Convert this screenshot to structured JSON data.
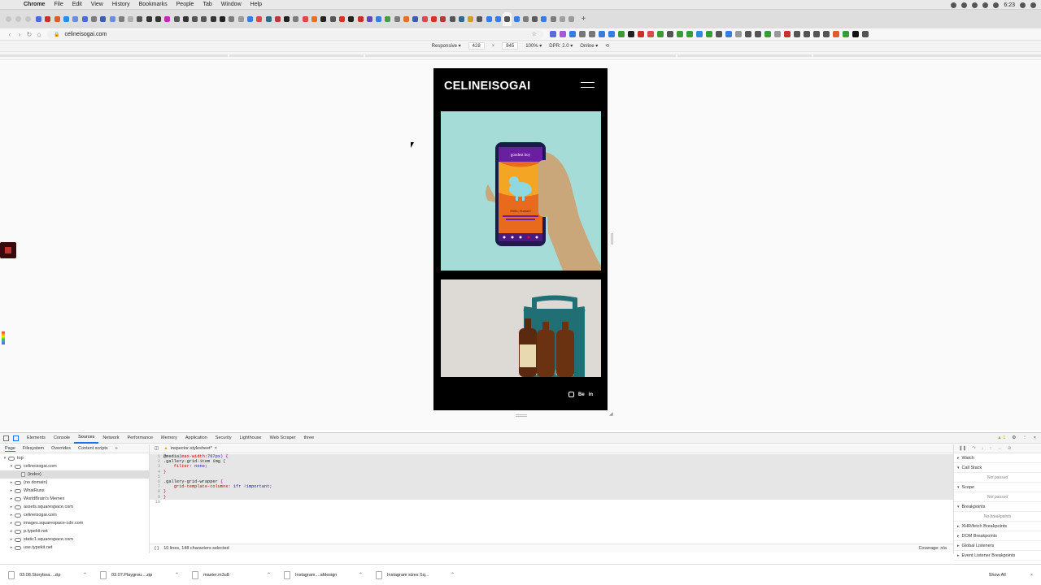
{
  "menubar": {
    "items": [
      "Chrome",
      "File",
      "Edit",
      "View",
      "History",
      "Bookmarks",
      "People",
      "Tab",
      "Window",
      "Help"
    ],
    "time": "6:23"
  },
  "tabs": {
    "favicon_colors": [
      "#4a6bd8",
      "#c9302c",
      "#e05a2b",
      "#2f8be0",
      "#6a8fd8",
      "#4a6bd8",
      "#7c7c7c",
      "#3a5fb0",
      "#6a8fd8",
      "#7c7c7c",
      "#b0b0b0",
      "#555555",
      "#333333",
      "#333333",
      "#c02ab5",
      "#555555",
      "#333333",
      "#555555",
      "#555555",
      "#333333",
      "#222222",
      "#7c7c7c",
      "#9a9a9a",
      "#3a7be0",
      "#d94a4a",
      "#2d6b8a",
      "#b53b3b",
      "#222222",
      "#7c7c7c",
      "#d94a4a",
      "#e0712b",
      "#222222",
      "#555555",
      "#d9302c",
      "#222222",
      "#c9302c",
      "#5d4ab5",
      "#3a7be0",
      "#4a9a4a",
      "#7c7c7c",
      "#e0712b",
      "#3a5fb0",
      "#d94a4a",
      "#d9302c",
      "#b53b3b",
      "#555555",
      "#2d6b8a",
      "#c9a02c",
      "#555555",
      "#3a7be0",
      "#3a7be0",
      "#555555",
      "#3a7be0",
      "#7c7c7c",
      "#5a5a5a",
      "#3a7be0",
      "#7c7c7c",
      "#a0a0a0",
      "#9a9a9a"
    ]
  },
  "address_bar": {
    "url": "celineisogai.com"
  },
  "device_toolbar": {
    "mode": "Responsive ▾",
    "width": "428",
    "height": "845",
    "zoom": "100% ▾",
    "dpr": "DPR: 2.0 ▾",
    "network": "Online ▾"
  },
  "site": {
    "logo": "CELINEISOGAI",
    "phone_screen_title": "goodest boy",
    "phone_screen_greeting": "Hello, Human!",
    "product_label": "HOOKER",
    "social": {
      "behance": "Be",
      "linkedin": "in"
    }
  },
  "devtools": {
    "tabs": [
      "Elements",
      "Console",
      "Sources",
      "Network",
      "Performance",
      "Memory",
      "Application",
      "Security",
      "Lighthouse",
      "Web Scraper",
      "three"
    ],
    "active_tab": "Sources",
    "warning_count": "1",
    "sources_subtabs": [
      "Page",
      "Filesystem",
      "Overrides",
      "Content scripts"
    ],
    "tree": [
      {
        "label": "top",
        "kind": "frame",
        "indent": 0,
        "arrow": "▾"
      },
      {
        "label": "celineisogai.com",
        "kind": "cloud",
        "indent": 1,
        "arrow": "▾"
      },
      {
        "label": "(index)",
        "kind": "file",
        "indent": 2,
        "arrow": ""
      },
      {
        "label": "(no domain)",
        "kind": "cloud",
        "indent": 1,
        "arrow": "▸"
      },
      {
        "label": "WhatRuns",
        "kind": "folder",
        "indent": 1,
        "arrow": "▸"
      },
      {
        "label": "WorldBrain's Memex",
        "kind": "folder",
        "indent": 1,
        "arrow": "▸"
      },
      {
        "label": "assets.squarespace.com",
        "kind": "cloud",
        "indent": 1,
        "arrow": "▸"
      },
      {
        "label": "celineisogai.com",
        "kind": "cloud",
        "indent": 1,
        "arrow": "▸"
      },
      {
        "label": "images.squarespace-cdn.com",
        "kind": "cloud",
        "indent": 1,
        "arrow": "▸"
      },
      {
        "label": "p.typekit.net",
        "kind": "cloud",
        "indent": 1,
        "arrow": "▸"
      },
      {
        "label": "static1.squarespace.com",
        "kind": "cloud",
        "indent": 1,
        "arrow": "▸"
      },
      {
        "label": "use.typekit.net",
        "kind": "cloud",
        "indent": 1,
        "arrow": "▸"
      }
    ],
    "editor_tab": "inspector-stylesheet*",
    "code_lines": [
      {
        "n": "1",
        "parts": [
          [
            "sel",
            "@media"
          ],
          [
            "",
            "("
          ],
          [
            "prop",
            "max-width"
          ],
          [
            "",
            ":"
          ],
          [
            "val",
            "767px"
          ],
          [
            "",
            ") {"
          ]
        ]
      },
      {
        "n": "2",
        "parts": [
          [
            "sel",
            ".gallery-grid-item img"
          ],
          [
            "",
            " {"
          ]
        ]
      },
      {
        "n": "3",
        "parts": [
          [
            "",
            "    "
          ],
          [
            "prop",
            "filter"
          ],
          [
            "",
            ": "
          ],
          [
            "val",
            "none"
          ],
          [
            "",
            ";"
          ]
        ]
      },
      {
        "n": "4",
        "parts": [
          [
            "",
            "}"
          ]
        ]
      },
      {
        "n": "5",
        "parts": [
          [
            "",
            ""
          ]
        ]
      },
      {
        "n": "6",
        "parts": [
          [
            "sel",
            ".gallery-grid-wrapper"
          ],
          [
            "",
            " {"
          ]
        ]
      },
      {
        "n": "7",
        "parts": [
          [
            "",
            "    "
          ],
          [
            "prop",
            "grid-template-columns"
          ],
          [
            "",
            ": "
          ],
          [
            "val",
            "1fr !important"
          ],
          [
            "",
            ";"
          ]
        ]
      },
      {
        "n": "8",
        "parts": [
          [
            "",
            "}"
          ]
        ]
      },
      {
        "n": "9",
        "parts": [
          [
            "",
            "}"
          ]
        ]
      },
      {
        "n": "10",
        "parts": [
          [
            "",
            ""
          ]
        ]
      }
    ],
    "status": "10 lines, 148 characters selected",
    "coverage": "Coverage: n/a",
    "debugger": {
      "watch": "Watch",
      "call_stack": "Call Stack",
      "not_paused_1": "Not paused",
      "scope": "Scope",
      "not_paused_2": "Not paused",
      "breakpoints": "Breakpoints",
      "no_breakpoints": "No breakpoints",
      "xhr": "XHR/fetch Breakpoints",
      "dom": "DOM Breakpoints",
      "global": "Global Listeners",
      "event": "Event Listener Breakpoints"
    }
  },
  "downloads": {
    "items": [
      "03.08.Storyboa....zip",
      "03.07.Playgrou....zip",
      "master.m3u8",
      "Instagram....afdesign",
      "Instagram sizes Sq..."
    ],
    "show_all": "Show All"
  }
}
